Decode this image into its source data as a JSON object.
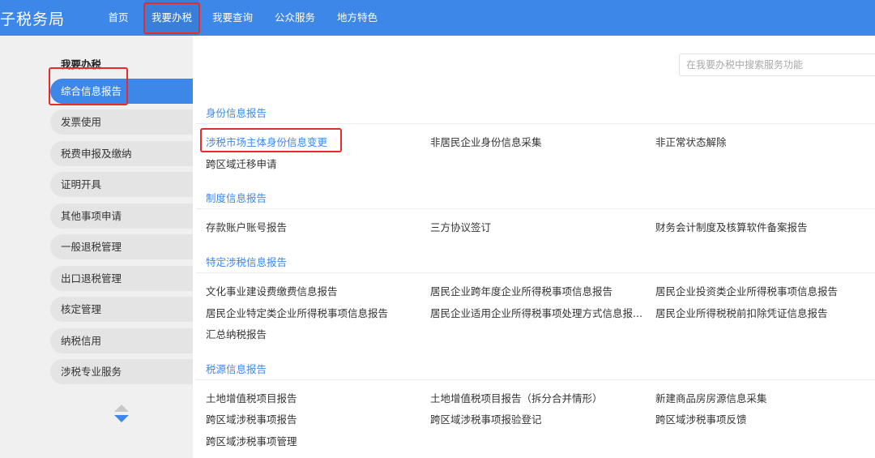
{
  "header": {
    "brand": "子税务局",
    "nav": [
      "首页",
      "我要办税",
      "我要查询",
      "公众服务",
      "地方特色"
    ],
    "active_nav": "我要办税"
  },
  "sidebar": {
    "title": "我要办税",
    "items": [
      "综合信息报告",
      "发票使用",
      "税费申报及缴纳",
      "证明开具",
      "其他事项申请",
      "一般退税管理",
      "出口退税管理",
      "核定管理",
      "纳税信用",
      "涉税专业服务"
    ],
    "active_item": "综合信息报告"
  },
  "search": {
    "placeholder": "在我要办税中搜索服务功能"
  },
  "sections": [
    {
      "title": "身份信息报告",
      "links": [
        "涉税市场主体身份信息变更",
        "非居民企业身份信息采集",
        "非正常状态解除",
        "跨区域迁移申请"
      ]
    },
    {
      "title": "制度信息报告",
      "links": [
        "存款账户账号报告",
        "三方协议签订",
        "财务会计制度及核算软件备案报告"
      ]
    },
    {
      "title": "特定涉税信息报告",
      "links": [
        "文化事业建设费缴费信息报告",
        "居民企业跨年度企业所得税事项信息报告",
        "居民企业投资类企业所得税事项信息报告",
        "居民企业特定类企业所得税事项信息报告",
        "居民企业适用企业所得税事项处理方式信息报...",
        "居民企业所得税税前扣除凭证信息报告",
        "汇总纳税报告"
      ]
    },
    {
      "title": "税源信息报告",
      "links": [
        "土地增值税项目报告",
        "土地增值税项目报告（拆分合并情形）",
        "新建商品房房源信息采集",
        "跨区域涉税事项报告",
        "跨区域涉税事项报验登记",
        "跨区域涉税事项反馈",
        "跨区域涉税事项管理"
      ]
    }
  ],
  "colors": {
    "primary": "#3d87e8",
    "highlight_border": "#e42c2c",
    "sidebar_bg": "#f0f0f0"
  }
}
